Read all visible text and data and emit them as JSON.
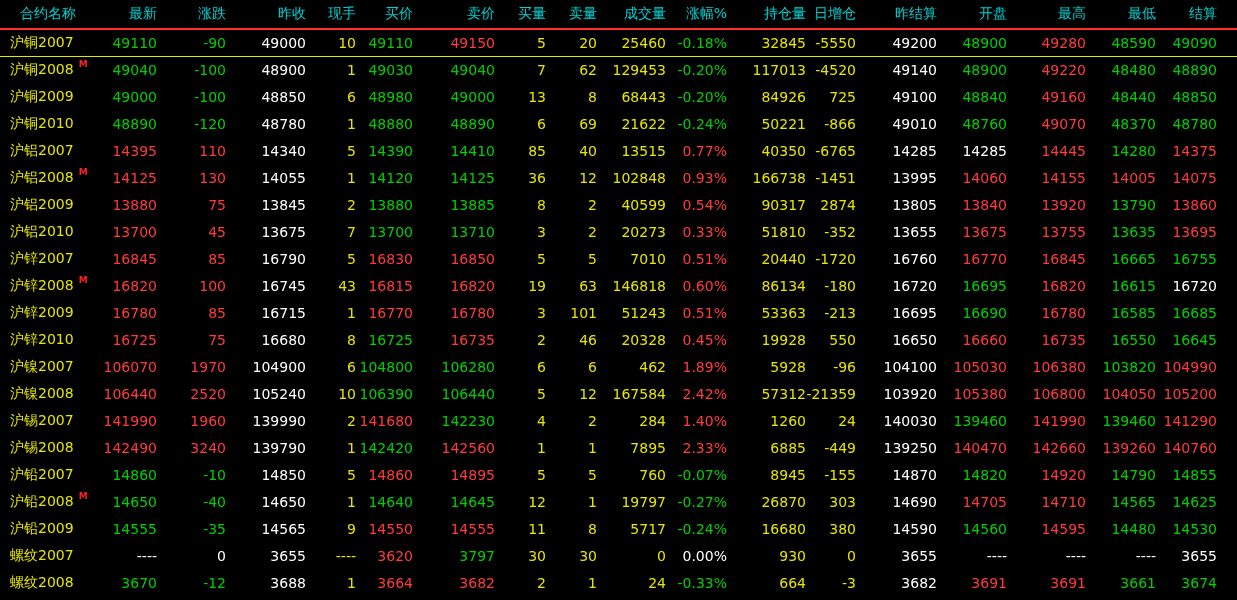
{
  "table": {
    "columns": [
      {
        "label": "合约名称",
        "color": "#e6e600"
      },
      {
        "label": "最新"
      },
      {
        "label": "涨跌"
      },
      {
        "label": "昨收",
        "color": "#ffffff"
      },
      {
        "label": "现手",
        "color": "#e6e600"
      },
      {
        "label": "买价"
      },
      {
        "label": "卖价"
      },
      {
        "label": "买量",
        "color": "#e6e600"
      },
      {
        "label": "卖量",
        "color": "#e6e600"
      },
      {
        "label": "成交量",
        "color": "#e6e600"
      },
      {
        "label": "涨幅%"
      },
      {
        "label": "持仓量",
        "color": "#e6e600"
      },
      {
        "label": "日增仓",
        "color": "#e6e600"
      },
      {
        "label": "昨结算",
        "color": "#ffffff"
      },
      {
        "label": "开盘"
      },
      {
        "label": "最高"
      },
      {
        "label": "最低"
      },
      {
        "label": "结算"
      }
    ],
    "rows": [
      {
        "selected": true,
        "cells": [
          {
            "text": "沪铜2007"
          },
          {
            "text": "49110",
            "color": "#00d000"
          },
          {
            "text": "-90",
            "color": "#00d000"
          },
          {
            "text": "49000"
          },
          {
            "text": "10"
          },
          {
            "text": "49110",
            "color": "#00d000"
          },
          {
            "text": "49150",
            "color": "#ff3c3c"
          },
          {
            "text": "5"
          },
          {
            "text": "20"
          },
          {
            "text": "25460"
          },
          {
            "text": "-0.18%",
            "color": "#00d000"
          },
          {
            "text": "32845"
          },
          {
            "text": "-5550"
          },
          {
            "text": "49200"
          },
          {
            "text": "48900",
            "color": "#00d000"
          },
          {
            "text": "49280",
            "color": "#ff3c3c"
          },
          {
            "text": "48590",
            "color": "#00d000"
          },
          {
            "text": "49090",
            "color": "#00d000"
          }
        ]
      },
      {
        "selected": false,
        "cells": [
          {
            "text": "沪铜2008",
            "badge": "M"
          },
          {
            "text": "49040",
            "color": "#00d000"
          },
          {
            "text": "-100",
            "color": "#00d000"
          },
          {
            "text": "48900"
          },
          {
            "text": "1"
          },
          {
            "text": "49030",
            "color": "#00d000"
          },
          {
            "text": "49040",
            "color": "#00d000"
          },
          {
            "text": "7"
          },
          {
            "text": "62"
          },
          {
            "text": "129453"
          },
          {
            "text": "-0.20%",
            "color": "#00d000"
          },
          {
            "text": "117013"
          },
          {
            "text": "-4520"
          },
          {
            "text": "49140"
          },
          {
            "text": "48900",
            "color": "#00d000"
          },
          {
            "text": "49220",
            "color": "#ff3c3c"
          },
          {
            "text": "48480",
            "color": "#00d000"
          },
          {
            "text": "48890",
            "color": "#00d000"
          }
        ]
      },
      {
        "selected": false,
        "cells": [
          {
            "text": "沪铜2009"
          },
          {
            "text": "49000",
            "color": "#00d000"
          },
          {
            "text": "-100",
            "color": "#00d000"
          },
          {
            "text": "48850"
          },
          {
            "text": "6"
          },
          {
            "text": "48980",
            "color": "#00d000"
          },
          {
            "text": "49000",
            "color": "#00d000"
          },
          {
            "text": "13"
          },
          {
            "text": "8"
          },
          {
            "text": "68443"
          },
          {
            "text": "-0.20%",
            "color": "#00d000"
          },
          {
            "text": "84926"
          },
          {
            "text": "725"
          },
          {
            "text": "49100"
          },
          {
            "text": "48840",
            "color": "#00d000"
          },
          {
            "text": "49160",
            "color": "#ff3c3c"
          },
          {
            "text": "48440",
            "color": "#00d000"
          },
          {
            "text": "48850",
            "color": "#00d000"
          }
        ]
      },
      {
        "selected": false,
        "cells": [
          {
            "text": "沪铜2010"
          },
          {
            "text": "48890",
            "color": "#00d000"
          },
          {
            "text": "-120",
            "color": "#00d000"
          },
          {
            "text": "48780"
          },
          {
            "text": "1"
          },
          {
            "text": "48880",
            "color": "#00d000"
          },
          {
            "text": "48890",
            "color": "#00d000"
          },
          {
            "text": "6"
          },
          {
            "text": "69"
          },
          {
            "text": "21622"
          },
          {
            "text": "-0.24%",
            "color": "#00d000"
          },
          {
            "text": "50221"
          },
          {
            "text": "-866"
          },
          {
            "text": "49010"
          },
          {
            "text": "48760",
            "color": "#00d000"
          },
          {
            "text": "49070",
            "color": "#ff3c3c"
          },
          {
            "text": "48370",
            "color": "#00d000"
          },
          {
            "text": "48780",
            "color": "#00d000"
          }
        ]
      },
      {
        "selected": false,
        "cells": [
          {
            "text": "沪铝2007"
          },
          {
            "text": "14395",
            "color": "#ff3c3c"
          },
          {
            "text": "110",
            "color": "#ff3c3c"
          },
          {
            "text": "14340"
          },
          {
            "text": "5"
          },
          {
            "text": "14390",
            "color": "#00d000"
          },
          {
            "text": "14410",
            "color": "#00d000"
          },
          {
            "text": "85"
          },
          {
            "text": "40"
          },
          {
            "text": "13515"
          },
          {
            "text": "0.77%",
            "color": "#ff3c3c"
          },
          {
            "text": "40350"
          },
          {
            "text": "-6765"
          },
          {
            "text": "14285"
          },
          {
            "text": "14285",
            "color": "#ffffff"
          },
          {
            "text": "14445",
            "color": "#ff3c3c"
          },
          {
            "text": "14280",
            "color": "#00d000"
          },
          {
            "text": "14375",
            "color": "#ff3c3c"
          }
        ]
      },
      {
        "selected": false,
        "cells": [
          {
            "text": "沪铝2008",
            "badge": "M"
          },
          {
            "text": "14125",
            "color": "#ff3c3c"
          },
          {
            "text": "130",
            "color": "#ff3c3c"
          },
          {
            "text": "14055"
          },
          {
            "text": "1"
          },
          {
            "text": "14120",
            "color": "#00d000"
          },
          {
            "text": "14125",
            "color": "#00d000"
          },
          {
            "text": "36"
          },
          {
            "text": "12"
          },
          {
            "text": "102848"
          },
          {
            "text": "0.93%",
            "color": "#ff3c3c"
          },
          {
            "text": "166738"
          },
          {
            "text": "-1451"
          },
          {
            "text": "13995"
          },
          {
            "text": "14060",
            "color": "#ff3c3c"
          },
          {
            "text": "14155",
            "color": "#ff3c3c"
          },
          {
            "text": "14005",
            "color": "#ff3c3c"
          },
          {
            "text": "14075",
            "color": "#ff3c3c"
          }
        ]
      },
      {
        "selected": false,
        "cells": [
          {
            "text": "沪铝2009"
          },
          {
            "text": "13880",
            "color": "#ff3c3c"
          },
          {
            "text": "75",
            "color": "#ff3c3c"
          },
          {
            "text": "13845"
          },
          {
            "text": "2"
          },
          {
            "text": "13880",
            "color": "#00d000"
          },
          {
            "text": "13885",
            "color": "#00d000"
          },
          {
            "text": "8"
          },
          {
            "text": "2"
          },
          {
            "text": "40599"
          },
          {
            "text": "0.54%",
            "color": "#ff3c3c"
          },
          {
            "text": "90317"
          },
          {
            "text": "2874"
          },
          {
            "text": "13805"
          },
          {
            "text": "13840",
            "color": "#ff3c3c"
          },
          {
            "text": "13920",
            "color": "#ff3c3c"
          },
          {
            "text": "13790",
            "color": "#00d000"
          },
          {
            "text": "13860",
            "color": "#ff3c3c"
          }
        ]
      },
      {
        "selected": false,
        "cells": [
          {
            "text": "沪铝2010"
          },
          {
            "text": "13700",
            "color": "#ff3c3c"
          },
          {
            "text": "45",
            "color": "#ff3c3c"
          },
          {
            "text": "13675"
          },
          {
            "text": "7"
          },
          {
            "text": "13700",
            "color": "#00d000"
          },
          {
            "text": "13710",
            "color": "#00d000"
          },
          {
            "text": "3"
          },
          {
            "text": "2"
          },
          {
            "text": "20273"
          },
          {
            "text": "0.33%",
            "color": "#ff3c3c"
          },
          {
            "text": "51810"
          },
          {
            "text": "-352"
          },
          {
            "text": "13655"
          },
          {
            "text": "13675",
            "color": "#ff3c3c"
          },
          {
            "text": "13755",
            "color": "#ff3c3c"
          },
          {
            "text": "13635",
            "color": "#00d000"
          },
          {
            "text": "13695",
            "color": "#ff3c3c"
          }
        ]
      },
      {
        "selected": false,
        "cells": [
          {
            "text": "沪锌2007"
          },
          {
            "text": "16845",
            "color": "#ff3c3c"
          },
          {
            "text": "85",
            "color": "#ff3c3c"
          },
          {
            "text": "16790"
          },
          {
            "text": "5"
          },
          {
            "text": "16830",
            "color": "#ff3c3c"
          },
          {
            "text": "16850",
            "color": "#ff3c3c"
          },
          {
            "text": "5"
          },
          {
            "text": "5"
          },
          {
            "text": "7010"
          },
          {
            "text": "0.51%",
            "color": "#ff3c3c"
          },
          {
            "text": "20440"
          },
          {
            "text": "-1720"
          },
          {
            "text": "16760"
          },
          {
            "text": "16770",
            "color": "#ff3c3c"
          },
          {
            "text": "16845",
            "color": "#ff3c3c"
          },
          {
            "text": "16665",
            "color": "#00d000"
          },
          {
            "text": "16755",
            "color": "#00d000"
          }
        ]
      },
      {
        "selected": false,
        "cells": [
          {
            "text": "沪锌2008",
            "badge": "M"
          },
          {
            "text": "16820",
            "color": "#ff3c3c"
          },
          {
            "text": "100",
            "color": "#ff3c3c"
          },
          {
            "text": "16745"
          },
          {
            "text": "43"
          },
          {
            "text": "16815",
            "color": "#ff3c3c"
          },
          {
            "text": "16820",
            "color": "#ff3c3c"
          },
          {
            "text": "19"
          },
          {
            "text": "63"
          },
          {
            "text": "146818"
          },
          {
            "text": "0.60%",
            "color": "#ff3c3c"
          },
          {
            "text": "86134"
          },
          {
            "text": "-180"
          },
          {
            "text": "16720"
          },
          {
            "text": "16695",
            "color": "#00d000"
          },
          {
            "text": "16820",
            "color": "#ff3c3c"
          },
          {
            "text": "16615",
            "color": "#00d000"
          },
          {
            "text": "16720",
            "color": "#ffffff"
          }
        ]
      },
      {
        "selected": false,
        "cells": [
          {
            "text": "沪锌2009"
          },
          {
            "text": "16780",
            "color": "#ff3c3c"
          },
          {
            "text": "85",
            "color": "#ff3c3c"
          },
          {
            "text": "16715"
          },
          {
            "text": "1"
          },
          {
            "text": "16770",
            "color": "#ff3c3c"
          },
          {
            "text": "16780",
            "color": "#ff3c3c"
          },
          {
            "text": "3"
          },
          {
            "text": "101"
          },
          {
            "text": "51243"
          },
          {
            "text": "0.51%",
            "color": "#ff3c3c"
          },
          {
            "text": "53363"
          },
          {
            "text": "-213"
          },
          {
            "text": "16695"
          },
          {
            "text": "16690",
            "color": "#00d000"
          },
          {
            "text": "16780",
            "color": "#ff3c3c"
          },
          {
            "text": "16585",
            "color": "#00d000"
          },
          {
            "text": "16685",
            "color": "#00d000"
          }
        ]
      },
      {
        "selected": false,
        "cells": [
          {
            "text": "沪锌2010"
          },
          {
            "text": "16725",
            "color": "#ff3c3c"
          },
          {
            "text": "75",
            "color": "#ff3c3c"
          },
          {
            "text": "16680"
          },
          {
            "text": "8"
          },
          {
            "text": "16725",
            "color": "#00d000"
          },
          {
            "text": "16735",
            "color": "#ff3c3c"
          },
          {
            "text": "2"
          },
          {
            "text": "46"
          },
          {
            "text": "20328"
          },
          {
            "text": "0.45%",
            "color": "#ff3c3c"
          },
          {
            "text": "19928"
          },
          {
            "text": "550"
          },
          {
            "text": "16650"
          },
          {
            "text": "16660",
            "color": "#ff3c3c"
          },
          {
            "text": "16735",
            "color": "#ff3c3c"
          },
          {
            "text": "16550",
            "color": "#00d000"
          },
          {
            "text": "16645",
            "color": "#00d000"
          }
        ]
      },
      {
        "selected": false,
        "cells": [
          {
            "text": "沪镍2007"
          },
          {
            "text": "106070",
            "color": "#ff3c3c"
          },
          {
            "text": "1970",
            "color": "#ff3c3c"
          },
          {
            "text": "104900"
          },
          {
            "text": "6"
          },
          {
            "text": "104800",
            "color": "#00d000"
          },
          {
            "text": "106280",
            "color": "#00d000"
          },
          {
            "text": "6"
          },
          {
            "text": "6"
          },
          {
            "text": "462"
          },
          {
            "text": "1.89%",
            "color": "#ff3c3c"
          },
          {
            "text": "5928"
          },
          {
            "text": "-96"
          },
          {
            "text": "104100"
          },
          {
            "text": "105030",
            "color": "#ff3c3c"
          },
          {
            "text": "106380",
            "color": "#ff3c3c"
          },
          {
            "text": "103820",
            "color": "#00d000"
          },
          {
            "text": "104990",
            "color": "#ff3c3c"
          }
        ]
      },
      {
        "selected": false,
        "cells": [
          {
            "text": "沪镍2008"
          },
          {
            "text": "106440",
            "color": "#ff3c3c"
          },
          {
            "text": "2520",
            "color": "#ff3c3c"
          },
          {
            "text": "105240"
          },
          {
            "text": "10"
          },
          {
            "text": "106390",
            "color": "#00d000"
          },
          {
            "text": "106440",
            "color": "#00d000"
          },
          {
            "text": "5"
          },
          {
            "text": "12"
          },
          {
            "text": "167584"
          },
          {
            "text": "2.42%",
            "color": "#ff3c3c"
          },
          {
            "text": "57312"
          },
          {
            "text": "-21359"
          },
          {
            "text": "103920"
          },
          {
            "text": "105380",
            "color": "#ff3c3c"
          },
          {
            "text": "106800",
            "color": "#ff3c3c"
          },
          {
            "text": "104050",
            "color": "#ff3c3c"
          },
          {
            "text": "105200",
            "color": "#ff3c3c"
          }
        ]
      },
      {
        "selected": false,
        "cells": [
          {
            "text": "沪锡2007"
          },
          {
            "text": "141990",
            "color": "#ff3c3c"
          },
          {
            "text": "1960",
            "color": "#ff3c3c"
          },
          {
            "text": "139990"
          },
          {
            "text": "2"
          },
          {
            "text": "141680",
            "color": "#ff3c3c"
          },
          {
            "text": "142230",
            "color": "#00d000"
          },
          {
            "text": "4"
          },
          {
            "text": "2"
          },
          {
            "text": "284"
          },
          {
            "text": "1.40%",
            "color": "#ff3c3c"
          },
          {
            "text": "1260"
          },
          {
            "text": "24"
          },
          {
            "text": "140030"
          },
          {
            "text": "139460",
            "color": "#00d000"
          },
          {
            "text": "141990",
            "color": "#ff3c3c"
          },
          {
            "text": "139460",
            "color": "#00d000"
          },
          {
            "text": "141290",
            "color": "#ff3c3c"
          }
        ]
      },
      {
        "selected": false,
        "cells": [
          {
            "text": "沪锡2008"
          },
          {
            "text": "142490",
            "color": "#ff3c3c"
          },
          {
            "text": "3240",
            "color": "#ff3c3c"
          },
          {
            "text": "139790"
          },
          {
            "text": "1"
          },
          {
            "text": "142420",
            "color": "#00d000"
          },
          {
            "text": "142560",
            "color": "#ff3c3c"
          },
          {
            "text": "1"
          },
          {
            "text": "1"
          },
          {
            "text": "7895"
          },
          {
            "text": "2.33%",
            "color": "#ff3c3c"
          },
          {
            "text": "6885"
          },
          {
            "text": "-449"
          },
          {
            "text": "139250"
          },
          {
            "text": "140470",
            "color": "#ff3c3c"
          },
          {
            "text": "142660",
            "color": "#ff3c3c"
          },
          {
            "text": "139260",
            "color": "#ff3c3c"
          },
          {
            "text": "140760",
            "color": "#ff3c3c"
          }
        ]
      },
      {
        "selected": false,
        "cells": [
          {
            "text": "沪铅2007"
          },
          {
            "text": "14860",
            "color": "#00d000"
          },
          {
            "text": "-10",
            "color": "#00d000"
          },
          {
            "text": "14850"
          },
          {
            "text": "5"
          },
          {
            "text": "14860",
            "color": "#ff3c3c"
          },
          {
            "text": "14895",
            "color": "#ff3c3c"
          },
          {
            "text": "5"
          },
          {
            "text": "5"
          },
          {
            "text": "760"
          },
          {
            "text": "-0.07%",
            "color": "#00d000"
          },
          {
            "text": "8945"
          },
          {
            "text": "-155"
          },
          {
            "text": "14870"
          },
          {
            "text": "14820",
            "color": "#00d000"
          },
          {
            "text": "14920",
            "color": "#ff3c3c"
          },
          {
            "text": "14790",
            "color": "#00d000"
          },
          {
            "text": "14855",
            "color": "#00d000"
          }
        ]
      },
      {
        "selected": false,
        "cells": [
          {
            "text": "沪铅2008",
            "badge": "M"
          },
          {
            "text": "14650",
            "color": "#00d000"
          },
          {
            "text": "-40",
            "color": "#00d000"
          },
          {
            "text": "14650"
          },
          {
            "text": "1"
          },
          {
            "text": "14640",
            "color": "#00d000"
          },
          {
            "text": "14645",
            "color": "#00d000"
          },
          {
            "text": "12"
          },
          {
            "text": "1"
          },
          {
            "text": "19797"
          },
          {
            "text": "-0.27%",
            "color": "#00d000"
          },
          {
            "text": "26870"
          },
          {
            "text": "303"
          },
          {
            "text": "14690"
          },
          {
            "text": "14705",
            "color": "#ff3c3c"
          },
          {
            "text": "14710",
            "color": "#ff3c3c"
          },
          {
            "text": "14565",
            "color": "#00d000"
          },
          {
            "text": "14625",
            "color": "#00d000"
          }
        ]
      },
      {
        "selected": false,
        "cells": [
          {
            "text": "沪铅2009"
          },
          {
            "text": "14555",
            "color": "#00d000"
          },
          {
            "text": "-35",
            "color": "#00d000"
          },
          {
            "text": "14565"
          },
          {
            "text": "9"
          },
          {
            "text": "14550",
            "color": "#ff3c3c"
          },
          {
            "text": "14555",
            "color": "#ff3c3c"
          },
          {
            "text": "11"
          },
          {
            "text": "8"
          },
          {
            "text": "5717"
          },
          {
            "text": "-0.24%",
            "color": "#00d000"
          },
          {
            "text": "16680"
          },
          {
            "text": "380"
          },
          {
            "text": "14590"
          },
          {
            "text": "14560",
            "color": "#00d000"
          },
          {
            "text": "14595",
            "color": "#ff3c3c"
          },
          {
            "text": "14480",
            "color": "#00d000"
          },
          {
            "text": "14530",
            "color": "#00d000"
          }
        ]
      },
      {
        "selected": false,
        "cells": [
          {
            "text": "螺纹2007"
          },
          {
            "text": "----",
            "color": "#ffffff"
          },
          {
            "text": "0",
            "color": "#ffffff"
          },
          {
            "text": "3655"
          },
          {
            "text": "----"
          },
          {
            "text": "3620",
            "color": "#ff3c3c"
          },
          {
            "text": "3797",
            "color": "#00d000"
          },
          {
            "text": "30"
          },
          {
            "text": "30"
          },
          {
            "text": "0"
          },
          {
            "text": "0.00%",
            "color": "#ffffff"
          },
          {
            "text": "930"
          },
          {
            "text": "0"
          },
          {
            "text": "3655"
          },
          {
            "text": "----",
            "color": "#ffffff"
          },
          {
            "text": "----",
            "color": "#ffffff"
          },
          {
            "text": "----",
            "color": "#ffffff"
          },
          {
            "text": "3655",
            "color": "#ffffff"
          }
        ]
      },
      {
        "selected": false,
        "cells": [
          {
            "text": "螺纹2008"
          },
          {
            "text": "3670",
            "color": "#00d000"
          },
          {
            "text": "-12",
            "color": "#00d000"
          },
          {
            "text": "3688"
          },
          {
            "text": "1"
          },
          {
            "text": "3664",
            "color": "#ff3c3c"
          },
          {
            "text": "3682",
            "color": "#ff3c3c"
          },
          {
            "text": "2"
          },
          {
            "text": "1"
          },
          {
            "text": "24"
          },
          {
            "text": "-0.33%",
            "color": "#00d000"
          },
          {
            "text": "664"
          },
          {
            "text": "-3"
          },
          {
            "text": "3682"
          },
          {
            "text": "3691",
            "color": "#ff3c3c"
          },
          {
            "text": "3691",
            "color": "#ff3c3c"
          },
          {
            "text": "3661",
            "color": "#00d000"
          },
          {
            "text": "3674",
            "color": "#00d000"
          }
        ]
      }
    ]
  }
}
